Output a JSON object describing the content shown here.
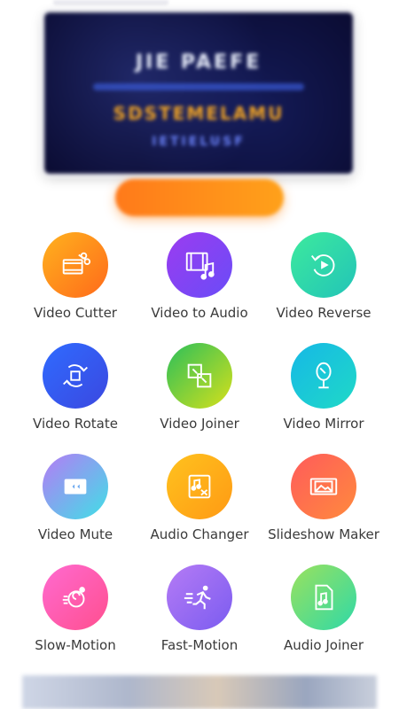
{
  "banner": {
    "line1": "JIE PAEFE",
    "line3": "SDSTEMELAMU",
    "line4": "IETIELUSF"
  },
  "cta": {
    "label": ""
  },
  "tools": [
    {
      "label": "Video Cutter",
      "icon": "video-cut-icon",
      "color_from": "#ffb21e",
      "color_to": "#ff6a1a"
    },
    {
      "label": "Video to Audio",
      "icon": "video-music-icon",
      "color_from": "#9b3cf0",
      "color_to": "#6a4cf7"
    },
    {
      "label": "Video Reverse",
      "icon": "reverse-icon",
      "color_from": "#3dea9d",
      "color_to": "#22c4b8"
    },
    {
      "label": "Video Rotate",
      "icon": "rotate-icon",
      "color_from": "#2f6bff",
      "color_to": "#3b48e0"
    },
    {
      "label": "Video Joiner",
      "icon": "joiner-icon",
      "color_from": "#2bbf5a",
      "color_to": "#d6e01b"
    },
    {
      "label": "Video Mirror",
      "icon": "mirror-icon",
      "color_from": "#16b8e6",
      "color_to": "#1fd9c7"
    },
    {
      "label": "Video Mute",
      "icon": "mute-camera-icon",
      "color_from": "#b57bf5",
      "color_to": "#3fe0e6"
    },
    {
      "label": "Audio Changer",
      "icon": "audio-changer-icon",
      "color_from": "#ffc21e",
      "color_to": "#ff9a14"
    },
    {
      "label": "Slideshow Maker",
      "icon": "slideshow-icon",
      "color_from": "#ff5b5b",
      "color_to": "#ff8a3d"
    },
    {
      "label": "Slow-Motion",
      "icon": "slow-motion-icon",
      "color_from": "#ff6ad0",
      "color_to": "#ff4f8f"
    },
    {
      "label": "Fast-Motion",
      "icon": "fast-motion-icon",
      "color_from": "#b57bf5",
      "color_to": "#7b5cf0"
    },
    {
      "label": "Audio Joiner",
      "icon": "audio-file-icon",
      "color_from": "#9be15d",
      "color_to": "#2fd9a7"
    }
  ]
}
